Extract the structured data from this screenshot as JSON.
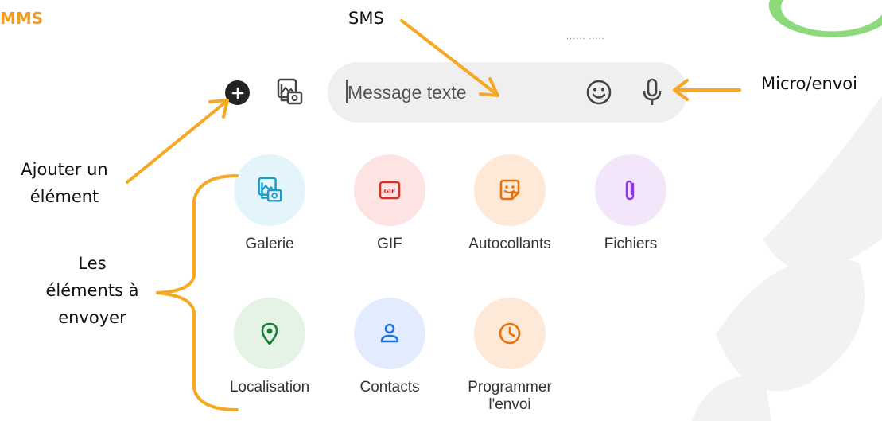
{
  "annotations": {
    "mms": "MMS",
    "sms": "SMS",
    "micro": "Micro/envoi",
    "ajouter_line1": "Ajouter un",
    "ajouter_line2": "élément",
    "elements_line1": "Les",
    "elements_line2": "éléments à",
    "elements_line3": "envoyer"
  },
  "compose": {
    "placeholder": "Message texte",
    "status_fragment": "...... ....."
  },
  "attachments": [
    {
      "label": "Galerie",
      "icon": "gallery-icon",
      "bg": "#e3f4fb",
      "fg": "#1d9bc4"
    },
    {
      "label": "GIF",
      "icon": "gif-icon",
      "bg": "#fde4e3",
      "fg": "#d93025"
    },
    {
      "label": "Autocollants",
      "icon": "sticker-icon",
      "bg": "#fee8d8",
      "fg": "#e8710a"
    },
    {
      "label": "Fichiers",
      "icon": "paperclip-icon",
      "bg": "#f3e6fb",
      "fg": "#9334e6"
    },
    {
      "label": "Localisation",
      "icon": "location-pin-icon",
      "bg": "#e4f3e6",
      "fg": "#188038"
    },
    {
      "label": "Contacts",
      "icon": "contact-person-icon",
      "bg": "#e3ecfd",
      "fg": "#1a73e8"
    },
    {
      "label": "Programmer",
      "label_line2": "l'envoi",
      "icon": "clock-icon",
      "bg": "#fee8d8",
      "fg": "#e8710a"
    }
  ],
  "colors": {
    "arrow": "#f7a823",
    "accent_text": "#f29b1d"
  }
}
